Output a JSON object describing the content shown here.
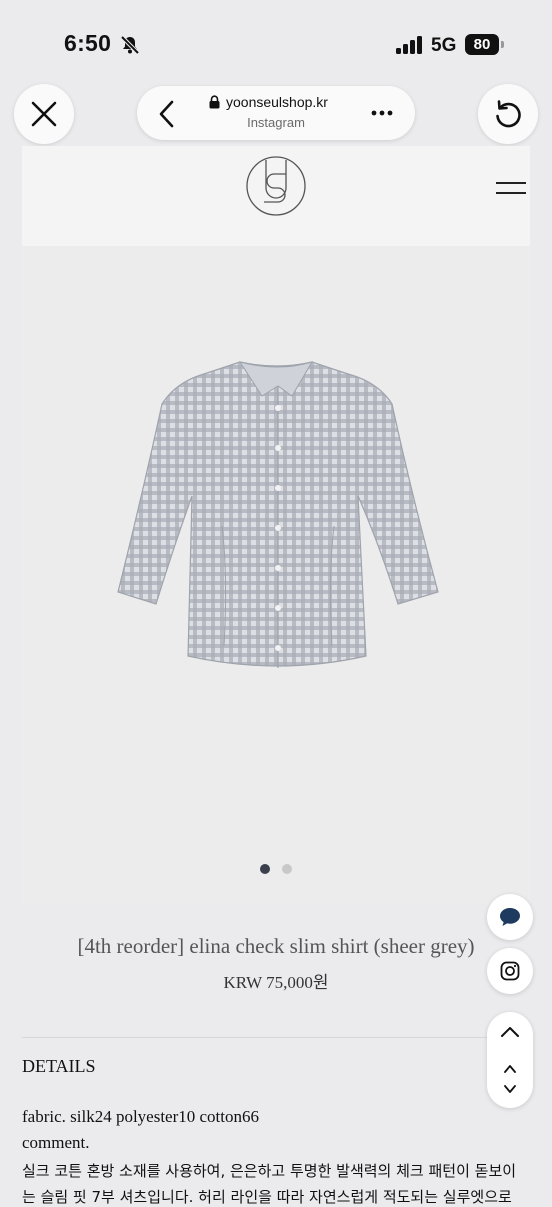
{
  "status_bar": {
    "time": "6:50",
    "network": "5G",
    "battery": "80"
  },
  "browser": {
    "domain": "yoonseulshop.kr",
    "source": "Instagram"
  },
  "product": {
    "title": "[4th reorder] elina check slim shirt (sheer grey)",
    "price": "KRW 75,000원",
    "carousel": {
      "count": 2,
      "active_index": 0
    }
  },
  "details": {
    "heading": "DETAILS",
    "lines": [
      "fabric. silk24 polyester10 cotton66",
      "comment.",
      "실크 코튼 혼방 소재를 사용하여, 은은하고 투명한 발색력의 체크 패턴이 돋보이",
      "는 슬림 핏 7부 셔츠입니다. 허리 라인을 따라 자연스럽게 적도되는 실루엣으로"
    ]
  },
  "icons": [
    "bell-slash-icon",
    "close-icon",
    "back-chevron-icon",
    "lock-icon",
    "more-icon",
    "reload-icon",
    "brand-logo",
    "hamburger-menu-icon",
    "chat-icon",
    "instagram-icon",
    "chevron-up-icon",
    "chevron-down-icon"
  ],
  "colors": {
    "background": "#ebebed",
    "page": "#f4f4f4",
    "dot_active": "#3a3f4b",
    "dot_inactive": "#c8c8c8"
  }
}
